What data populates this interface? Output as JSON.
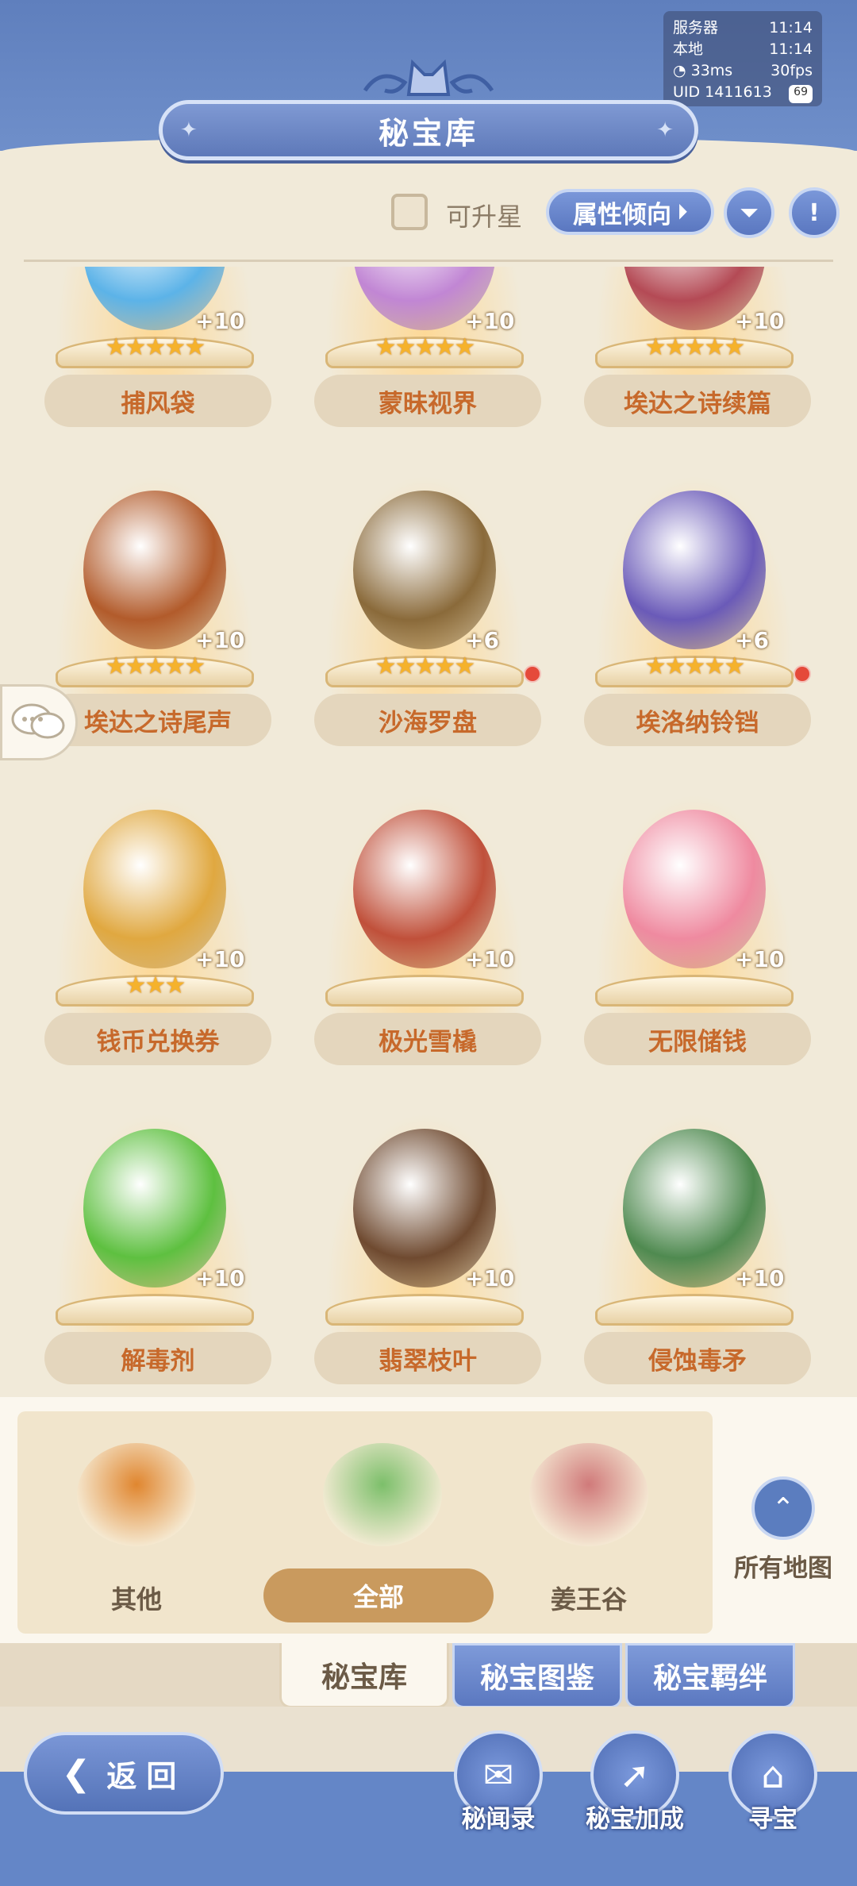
{
  "status": {
    "server_label": "服务器",
    "server_time": "11:14",
    "local_label": "本地",
    "local_time": "11:14",
    "ping": "33ms",
    "fps": "30fps",
    "uid": "UID 1411613",
    "badge": "69"
  },
  "header": {
    "title": "秘宝库"
  },
  "filters": {
    "upgradable_label": "可升星",
    "attribute_button": "属性倾向"
  },
  "items": [
    {
      "name": "捕风袋",
      "level": "+10",
      "stars": "★★★★★",
      "color": "#5cb3e8",
      "dot": false
    },
    {
      "name": "蒙昧视界",
      "level": "+10",
      "stars": "★★★★★",
      "color": "#c186d4",
      "dot": false
    },
    {
      "name": "埃达之诗续篇",
      "level": "+10",
      "stars": "★★★★★",
      "color": "#b44a55",
      "dot": false
    },
    {
      "name": "埃达之诗尾声",
      "level": "+10",
      "stars": "★★★★★",
      "color": "#b25b2b",
      "dot": false
    },
    {
      "name": "沙海罗盘",
      "level": "+6",
      "stars": "★★★★★",
      "color": "#8a6a3a",
      "dot": true
    },
    {
      "name": "埃洛纳铃铛",
      "level": "+6",
      "stars": "★★★★★",
      "color": "#6a5ab8",
      "dot": true
    },
    {
      "name": "钱币兑换券",
      "level": "+10",
      "stars": "★★★",
      "color": "#e0a840",
      "dot": false
    },
    {
      "name": "极光雪橇",
      "level": "+10",
      "stars": "",
      "color": "#c0503a",
      "dot": false
    },
    {
      "name": "无限储钱",
      "level": "+10",
      "stars": "",
      "color": "#ef8aa0",
      "dot": false
    },
    {
      "name": "解毒剂",
      "level": "+10",
      "stars": "",
      "color": "#5ec040",
      "dot": false
    },
    {
      "name": "翡翠枝叶",
      "level": "+10",
      "stars": "",
      "color": "#6f4a30",
      "dot": false
    },
    {
      "name": "侵蚀毒矛",
      "level": "+10",
      "stars": "",
      "color": "#4f8a50",
      "dot": false
    }
  ],
  "regions": [
    {
      "label": "其他",
      "color": "#e0862f"
    },
    {
      "label": "全部",
      "color": "#7cbf6a"
    },
    {
      "label": "姜王谷",
      "color": "#d07a7a"
    }
  ],
  "all_maps_label": "所有地图",
  "tabs": [
    "秘宝库",
    "秘宝图鉴",
    "秘宝羁绊"
  ],
  "back_label": "返回",
  "actions": [
    "秘闻录",
    "秘宝加成",
    "寻宝"
  ]
}
